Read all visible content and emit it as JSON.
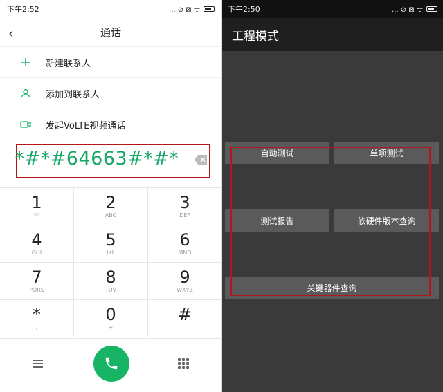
{
  "left": {
    "status": {
      "time": "下午2:52",
      "indicators": "... ⊘ ⊠ ᯤ"
    },
    "title": "通话",
    "menu_items": [
      {
        "icon": "plus-icon",
        "label": "新建联系人"
      },
      {
        "icon": "person-icon",
        "label": "添加到联系人"
      },
      {
        "icon": "video-icon",
        "label": "发起VoLTE视频通话"
      }
    ],
    "dial_input": "*#*#64663#*#*",
    "keypad": [
      [
        {
          "digit": "1",
          "sub": "ᴼᴼ"
        },
        {
          "digit": "2",
          "sub": "ABC"
        },
        {
          "digit": "3",
          "sub": "DEF"
        }
      ],
      [
        {
          "digit": "4",
          "sub": "GHI"
        },
        {
          "digit": "5",
          "sub": "JKL"
        },
        {
          "digit": "6",
          "sub": "MNO"
        }
      ],
      [
        {
          "digit": "7",
          "sub": "PQRS"
        },
        {
          "digit": "8",
          "sub": "TUV"
        },
        {
          "digit": "9",
          "sub": "WXYZ"
        }
      ],
      [
        {
          "digit": "*",
          "sub": ","
        },
        {
          "digit": "0",
          "sub": "+"
        },
        {
          "digit": "#",
          "sub": ""
        }
      ]
    ]
  },
  "right": {
    "status": {
      "time": "下午2:50",
      "indicators": "... ⊘ ⊠ ᯤ"
    },
    "title": "工程模式",
    "buttons": [
      "自动测试",
      "单项测试",
      "测试报告",
      "软硬件版本查询",
      "关键器件查询"
    ]
  },
  "colors": {
    "accent_green": "#16b464",
    "highlight_red": "#b3171d",
    "dark_bg": "#3a3a3a"
  }
}
